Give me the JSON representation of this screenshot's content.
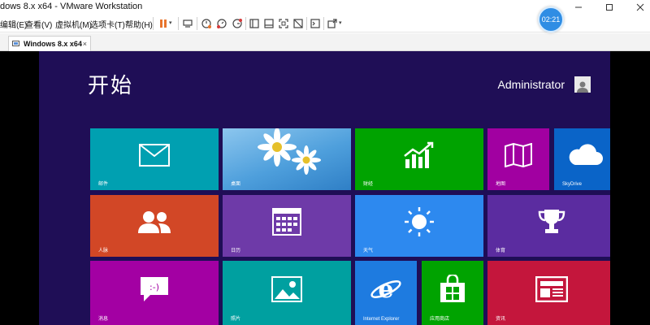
{
  "window": {
    "title": "dows 8.x x64 - VMware Workstation"
  },
  "menu": {
    "items": [
      "编辑(E)",
      "查看(V)",
      "虚拟机(M)",
      "选项卡(T)",
      "帮助(H)"
    ]
  },
  "toolbar": {
    "clock_badge": "02:21",
    "icons": [
      "pause-icon",
      "send-keys-icon",
      "snapshot-icon",
      "revert-snapshot-icon",
      "snapshot-manager-icon",
      "sidebar-icon",
      "thumbnail-icon",
      "fullscreen-icon",
      "no-console-icon",
      "console-view-icon",
      "stretch-icon"
    ]
  },
  "tabs": [
    {
      "label": "Windows 8.x x64",
      "close": "×"
    }
  ],
  "start_screen": {
    "title": "开始",
    "user_name": "Administrator",
    "background_color": "#1f0e56",
    "tiles": [
      {
        "label": "邮件",
        "icon": "mail-icon",
        "color": "#00a0b1"
      },
      {
        "label": "桌面",
        "icon": "desktop-flower-icon",
        "color": "#5aa8e0"
      },
      {
        "label": "财经",
        "icon": "finance-chart-icon",
        "color": "#00a300"
      },
      {
        "label": "地图",
        "icon": "map-icon",
        "color": "#a100a1"
      },
      {
        "label": "SkyDrive",
        "icon": "cloud-icon",
        "color": "#0a64c8"
      },
      {
        "label": "人脉",
        "icon": "people-icon",
        "color": "#d24726"
      },
      {
        "label": "日历",
        "icon": "calendar-icon",
        "color": "#6e3aa8"
      },
      {
        "label": "天气",
        "icon": "weather-sun-icon",
        "color": "#2d89ef"
      },
      {
        "label": "体育",
        "icon": "trophy-icon",
        "color": "#5b2ca0"
      },
      {
        "label": "消息",
        "icon": "messaging-icon",
        "color": "#a300a3"
      },
      {
        "label": "照片",
        "icon": "photos-icon",
        "color": "#00a0a0"
      },
      {
        "label": "Internet Explorer",
        "icon": "ie-icon",
        "color": "#1e7be0"
      },
      {
        "label": "应用商店",
        "icon": "store-icon",
        "color": "#00a300"
      },
      {
        "label": "资讯",
        "icon": "news-icon",
        "color": "#c4163c"
      }
    ]
  }
}
